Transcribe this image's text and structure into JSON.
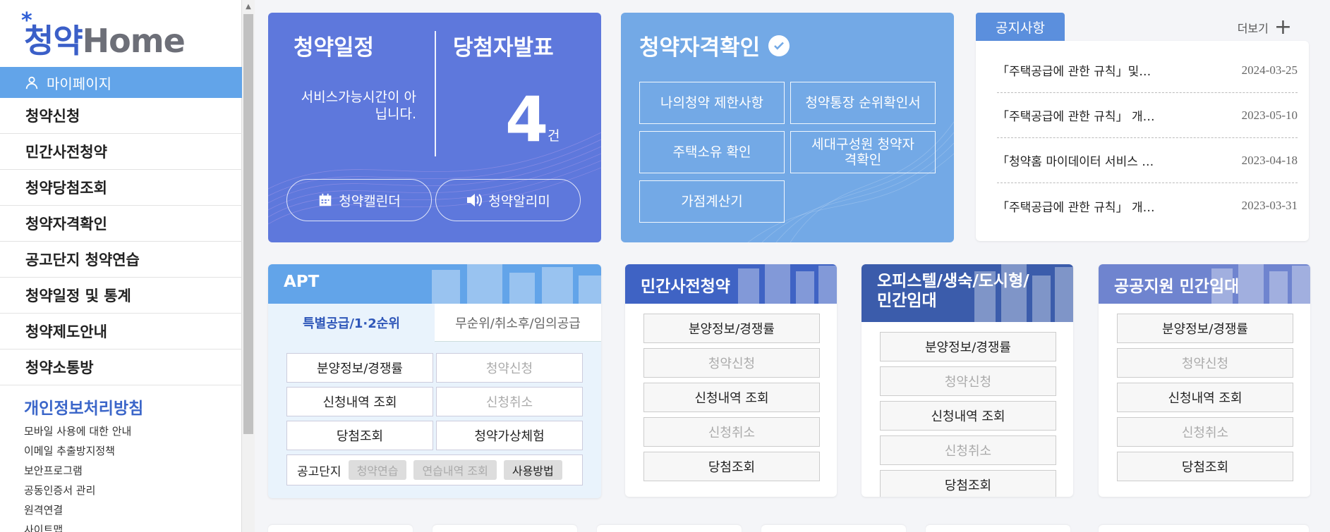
{
  "logo": {
    "prefix": "청약",
    "suffix": "Home"
  },
  "sidebar": {
    "mypage": "마이페이지",
    "menu": [
      "청약신청",
      "민간사전청약",
      "청약당첨조회",
      "청약자격확인",
      "공고단지 청약연습",
      "청약일정 및 통계",
      "청약제도안내",
      "청약소통방"
    ],
    "privacy_title": "개인정보처리방침",
    "links": [
      "모바일 사용에 대한 안내",
      "이메일 추출방지정책",
      "보안프로그램",
      "공동인증서 관리",
      "원격연결",
      "사이트맵"
    ]
  },
  "schedule_card": {
    "title_schedule": "청약일정",
    "title_winner": "당첨자발표",
    "message": "서비스가능시간이 아닙니다.",
    "winner_count": "4",
    "winner_unit": "건",
    "btn_calendar": "청약캘린더",
    "btn_alarm": "청약알리미"
  },
  "qualify_card": {
    "title": "청약자격확인",
    "buttons": [
      "나의청약 제한사항",
      "청약통장 순위확인서",
      "주택소유 확인",
      "세대구성원 청약자격확인",
      "가점계산기"
    ]
  },
  "notice": {
    "tab": "공지사항",
    "more": "더보기",
    "items": [
      {
        "title": "「주택공급에 관한 규칙」및…",
        "date": "2024-03-25"
      },
      {
        "title": "「주택공급에 관한 규칙」 개…",
        "date": "2023-05-10"
      },
      {
        "title": "「청약홈 마이데이터 서비스 …",
        "date": "2023-04-18"
      },
      {
        "title": "「주택공급에 관한 규칙」 개…",
        "date": "2023-03-31"
      }
    ]
  },
  "apt": {
    "title": "APT",
    "tab_active": "특별공급/1·2순위",
    "tab_inactive": "무순위/취소후/임의공급",
    "buttons": [
      "분양정보/경쟁률",
      "청약신청",
      "신청내역 조회",
      "신청취소",
      "당첨조회",
      "청약가상체험"
    ],
    "gongo_label": "공고단지",
    "gongo_chips": [
      "청약연습",
      "연습내역 조회",
      "사용방법"
    ]
  },
  "pre_sale": {
    "title": "민간사전청약",
    "buttons": [
      "분양정보/경쟁률",
      "청약신청",
      "신청내역 조회",
      "신청취소",
      "당첨조회"
    ]
  },
  "officetel": {
    "title_line1": "오피스텔/생숙/도시형/",
    "title_line2": "민간임대",
    "buttons": [
      "분양정보/경쟁률",
      "청약신청",
      "신청내역 조회",
      "신청취소",
      "당첨조회"
    ]
  },
  "public_rental": {
    "title": "공공지원 민간임대",
    "buttons": [
      "분양정보/경쟁률",
      "청약신청",
      "신청내역 조회",
      "신청취소",
      "당첨조회"
    ]
  }
}
